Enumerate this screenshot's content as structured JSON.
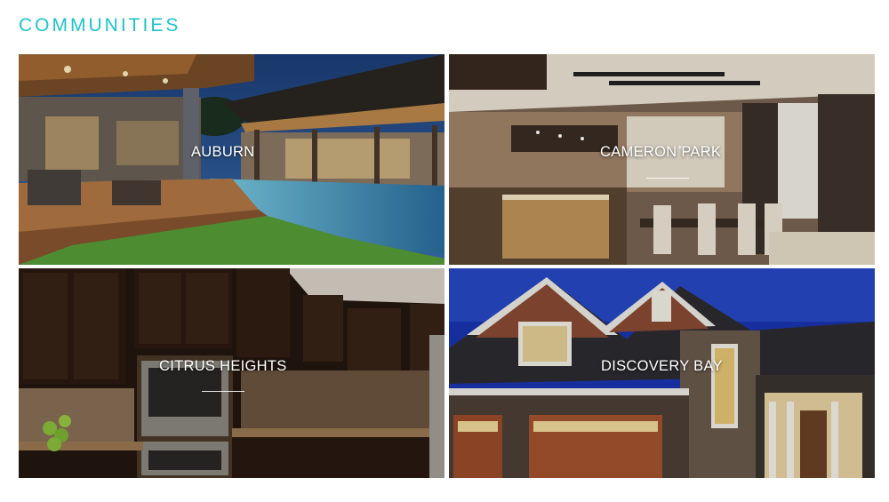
{
  "page": {
    "title": "COMMUNITIES"
  },
  "communities": [
    {
      "name": "AUBURN"
    },
    {
      "name": "CAMERON PARK"
    },
    {
      "name": "CITRUS HEIGHTS"
    },
    {
      "name": "DISCOVERY BAY"
    }
  ],
  "colors": {
    "accent": "#1fc3c8"
  }
}
